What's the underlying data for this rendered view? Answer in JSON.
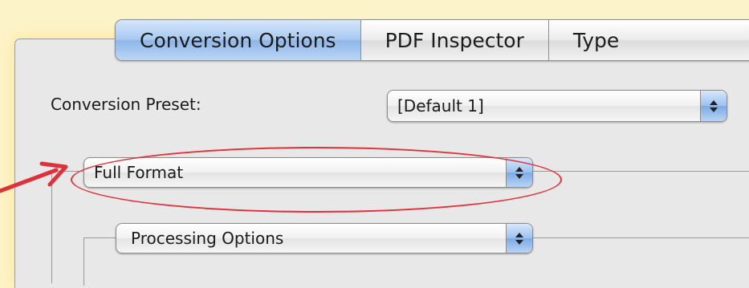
{
  "tabs": [
    {
      "label": "Conversion Options",
      "active": true
    },
    {
      "label": "PDF Inspector",
      "active": false
    },
    {
      "label": "Type",
      "active": false
    }
  ],
  "conversion_preset": {
    "label": "Conversion Preset:",
    "value": "[Default 1]"
  },
  "format_popup": {
    "value": "Full Format"
  },
  "processing_popup": {
    "value": "Processing Options"
  },
  "colors": {
    "annotation": "#e0303a",
    "accent_blue": "#8fb6e8",
    "background": "#fdf3c9"
  },
  "icons": {
    "popup_arrows": "up-down-chevron-icon",
    "annotation_arrow": "arrow-right-icon"
  }
}
